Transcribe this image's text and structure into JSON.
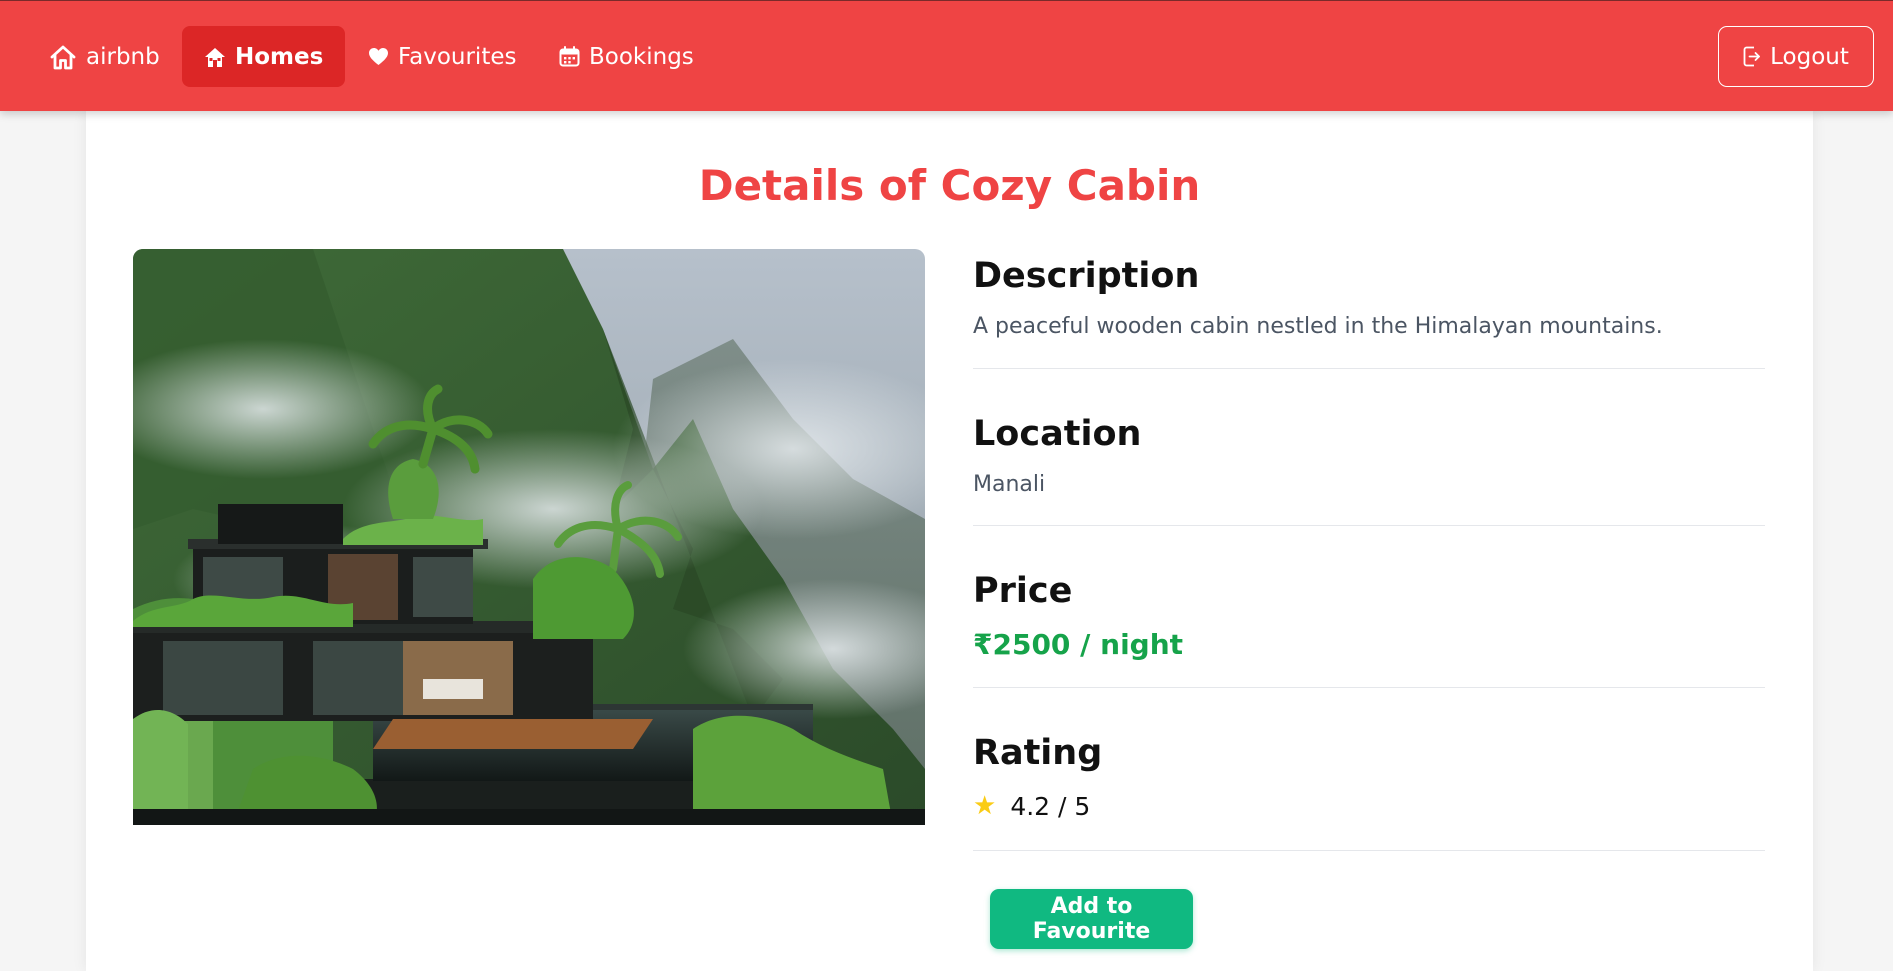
{
  "nav": {
    "brand": "airbnb",
    "items": [
      {
        "label": "Homes",
        "icon": "house-icon",
        "active": true
      },
      {
        "label": "Favourites",
        "icon": "heart-icon",
        "active": false
      },
      {
        "label": "Bookings",
        "icon": "calendar-icon",
        "active": false
      }
    ],
    "logout": "Logout"
  },
  "page": {
    "title": "Details of Cozy Cabin"
  },
  "details": {
    "description_label": "Description",
    "description": "A peaceful wooden cabin nestled in the Himalayan mountains.",
    "location_label": "Location",
    "location": "Manali",
    "price_label": "Price",
    "price": "₹2500 / night",
    "rating_label": "Rating",
    "rating": "4.2 / 5"
  },
  "actions": {
    "add_favourite": "Add to Favourite"
  },
  "colors": {
    "navbar": "#ef4444",
    "active_nav": "#dc2626",
    "title": "#ef4444",
    "price": "#16a34a",
    "button": "#10b981",
    "star": "#facc15"
  }
}
